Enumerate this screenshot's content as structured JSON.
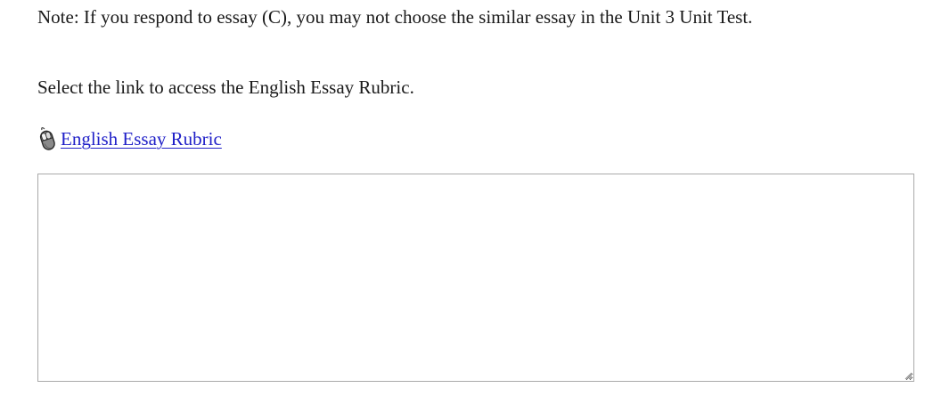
{
  "note": {
    "text": "Note: If you respond to essay (C), you may not choose the similar essay in the Unit 3 Unit Test."
  },
  "instruction": {
    "text": "Select the link to access the English Essay Rubric."
  },
  "rubric_link": {
    "icon": "computer-mouse-icon",
    "label": "English Essay Rubric"
  },
  "answer_box": {
    "value": "",
    "placeholder": ""
  },
  "colors": {
    "link": "#2020c8",
    "text": "#1a1a1a",
    "box_border": "#a9a9a9"
  }
}
